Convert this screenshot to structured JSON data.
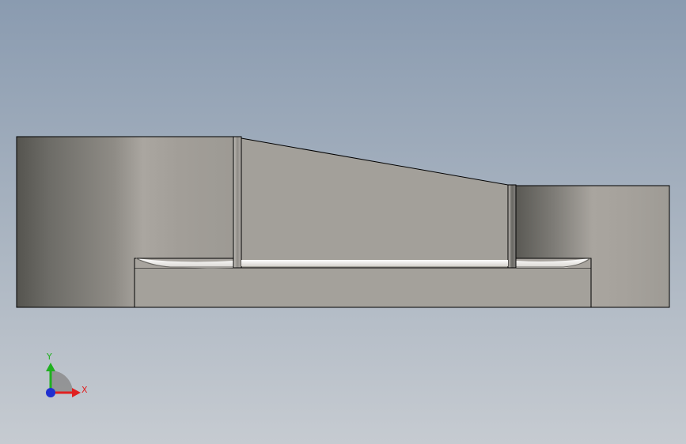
{
  "view": {
    "background_top": "#8a9bb0",
    "background_bottom": "#c6cbd1"
  },
  "triad": {
    "x_label": "X",
    "y_label": "Y",
    "x_color": "#e02020",
    "y_color": "#20b020",
    "z_color": "#2030d0"
  }
}
